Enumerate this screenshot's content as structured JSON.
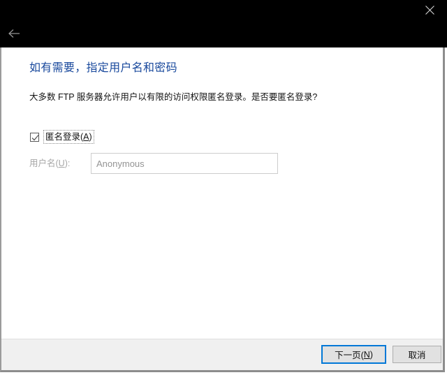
{
  "window": {
    "titlebar": {
      "close_icon": "close-icon",
      "back_icon": "back-arrow-icon"
    }
  },
  "page": {
    "heading": "如有需要，指定用户名和密码",
    "description": "大多数 FTP 服务器允许用户以有限的访问权限匿名登录。是否要匿名登录?"
  },
  "form": {
    "anonymous_checkbox": {
      "label_prefix": "匿名登录(",
      "accelerator": "A",
      "label_suffix": ")",
      "checked": true
    },
    "username": {
      "label_prefix": "用户名(",
      "accelerator": "U",
      "label_suffix": "):",
      "value": "Anonymous",
      "placeholder": "Anonymous",
      "disabled": true
    }
  },
  "footer": {
    "next_button": {
      "label_prefix": "下一页(",
      "accelerator": "N",
      "label_suffix": ")"
    },
    "cancel_button": {
      "label": "取消"
    }
  },
  "colors": {
    "titlebar_bg": "#000000",
    "heading": "#18489c",
    "accent_focus": "#0078d7",
    "footer_bg": "#f0f0f0",
    "disabled_text": "#a6a6a6"
  }
}
